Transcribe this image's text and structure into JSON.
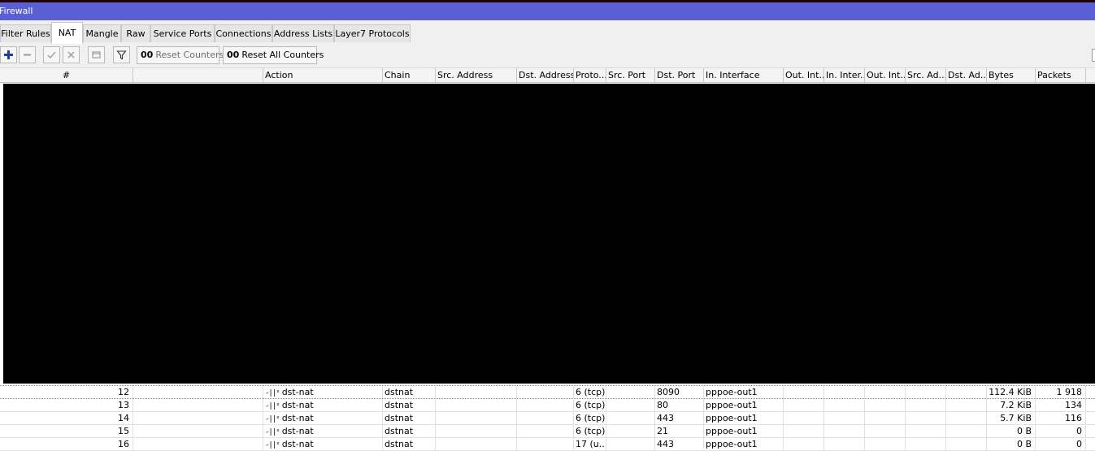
{
  "window": {
    "title": "Firewall"
  },
  "tabs": [
    {
      "label": "Filter Rules"
    },
    {
      "label": "NAT"
    },
    {
      "label": "Mangle"
    },
    {
      "label": "Raw"
    },
    {
      "label": "Service Ports"
    },
    {
      "label": "Connections"
    },
    {
      "label": "Address Lists"
    },
    {
      "label": "Layer7 Protocols"
    }
  ],
  "active_tab": "NAT",
  "toolbar": {
    "icons": [
      "add-icon",
      "remove-icon",
      "enable-icon",
      "disable-icon",
      "comment-icon",
      "filter-icon"
    ],
    "reset_counters_label": "Reset Counters",
    "reset_all_counters_label": "Reset All Counters",
    "counter_prefix": "00"
  },
  "columns": [
    {
      "label": "#"
    },
    {
      "label": ""
    },
    {
      "label": "Action"
    },
    {
      "label": "Chain"
    },
    {
      "label": "Src. Address"
    },
    {
      "label": "Dst. Address"
    },
    {
      "label": "Proto..."
    },
    {
      "label": "Src. Port"
    },
    {
      "label": "Dst. Port"
    },
    {
      "label": "In. Interface"
    },
    {
      "label": "Out. Int..."
    },
    {
      "label": "In. Inter..."
    },
    {
      "label": "Out. Int..."
    },
    {
      "label": "Src. Ad..."
    },
    {
      "label": "Dst. Ad..."
    },
    {
      "label": "Bytes"
    },
    {
      "label": "Packets"
    }
  ],
  "rows": [
    {
      "num": "12",
      "action": "dst-nat",
      "chain": "dstnat",
      "proto": "6 (tcp)",
      "dst_port": "8090",
      "in_interface": "pppoe-out1",
      "bytes": "112.4 KiB",
      "packets": "1 918"
    },
    {
      "num": "13",
      "action": "dst-nat",
      "chain": "dstnat",
      "proto": "6 (tcp)",
      "dst_port": "80",
      "in_interface": "pppoe-out1",
      "bytes": "7.2 KiB",
      "packets": "134"
    },
    {
      "num": "14",
      "action": "dst-nat",
      "chain": "dstnat",
      "proto": "6 (tcp)",
      "dst_port": "443",
      "in_interface": "pppoe-out1",
      "bytes": "5.7 KiB",
      "packets": "116"
    },
    {
      "num": "15",
      "action": "dst-nat",
      "chain": "dstnat",
      "proto": "6 (tcp)",
      "dst_port": "21",
      "in_interface": "pppoe-out1",
      "bytes": "0 B",
      "packets": "0"
    },
    {
      "num": "16",
      "action": "dst-nat",
      "chain": "dstnat",
      "proto": "17 (u...",
      "dst_port": "443",
      "in_interface": "pppoe-out1",
      "bytes": "0 B",
      "packets": "0"
    }
  ],
  "colors": {
    "titlebar": "#5a5fd3",
    "add_icon": "#1a3fa0"
  }
}
